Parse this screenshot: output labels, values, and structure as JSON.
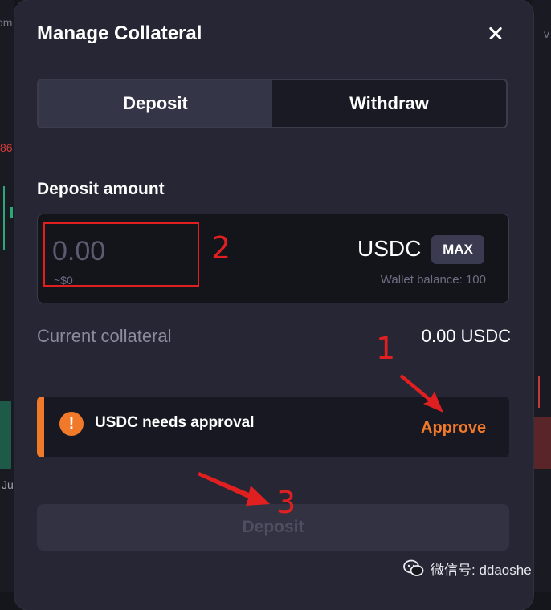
{
  "background": {
    "top_left_fragment": "om",
    "top_right_fragment": "v",
    "red_number_fragment": "86",
    "bottom_left_fragment": "Ju"
  },
  "modal": {
    "title": "Manage Collateral",
    "tabs": [
      {
        "label": "Deposit",
        "active": true
      },
      {
        "label": "Withdraw",
        "active": false
      }
    ],
    "deposit_amount_label": "Deposit amount",
    "amount": {
      "placeholder": "0.00",
      "usd_value": "~$0",
      "token": "USDC",
      "max_label": "MAX",
      "wallet_balance": "Wallet balance: 100"
    },
    "current_collateral": {
      "label": "Current collateral",
      "value": "0.00 USDC"
    },
    "approval": {
      "icon": "exclamation-icon",
      "message": "USDC needs approval",
      "action_label": "Approve"
    },
    "deposit_button_label": "Deposit"
  },
  "annotations": {
    "numbers": [
      "2",
      "1",
      "3"
    ],
    "color": "#e02020"
  },
  "watermark": {
    "text": "微信号: ddaoshe",
    "icon": "wechat-icon"
  },
  "colors": {
    "accent": "#f07a2a",
    "modal_bg": "#262635",
    "input_bg": "#14141b"
  }
}
